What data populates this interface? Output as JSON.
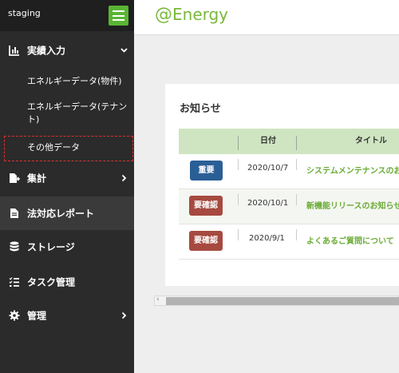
{
  "sidebar": {
    "env_label": "staging",
    "items": [
      {
        "label": "実績入力",
        "icon": "bar-chart-icon"
      },
      {
        "label": "集計",
        "icon": "file-export-icon"
      },
      {
        "label": "法対応レポート",
        "icon": "document-icon"
      },
      {
        "label": "ストレージ",
        "icon": "database-icon"
      },
      {
        "label": "タスク管理",
        "icon": "task-list-icon"
      },
      {
        "label": "管理",
        "icon": "gear-icon"
      }
    ],
    "sub_items": [
      {
        "label": "エネルギーデータ(物件)"
      },
      {
        "label": "エネルギーデータ(テナント)"
      },
      {
        "label": "その他データ"
      }
    ]
  },
  "header": {
    "logo_at": "@",
    "logo_text": "Energy"
  },
  "notices": {
    "title": "お知らせ",
    "columns": [
      "日付",
      "タイトル"
    ],
    "rows": [
      {
        "badge": "重要",
        "date": "2020/10/7",
        "title": "システムメンテナンスのお"
      },
      {
        "badge": "要確認",
        "date": "2020/10/1",
        "title": "新機能リリースのお知らせ"
      },
      {
        "badge": "要確認",
        "date": "2020/9/1",
        "title": "よくあるご質問について"
      }
    ]
  },
  "colors": {
    "accent": "#5ab535",
    "link": "#6aab35",
    "badge_important": "#2a5f96",
    "badge_confirm": "#a64a40"
  }
}
